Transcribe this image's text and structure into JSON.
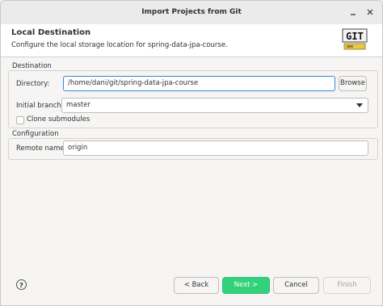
{
  "window": {
    "title": "Import Projects from Git"
  },
  "header": {
    "title": "Local Destination",
    "subtitle": "Configure the local storage location for spring-data-jpa-course.",
    "logo_text": "GIT"
  },
  "destination": {
    "group_label": "Destination",
    "directory_label": "Directory:",
    "directory_value": "/home/dani/git/spring-data-jpa-course",
    "browse_label": "Browse",
    "initial_branch_label": "Initial branch:",
    "initial_branch_value": "master",
    "clone_submodules_label": "Clone submodules"
  },
  "configuration": {
    "group_label": "Configuration",
    "remote_name_label": "Remote name:",
    "remote_name_value": "origin"
  },
  "footer": {
    "help_icon": "?",
    "back_label": "< Back",
    "next_label": "Next >",
    "cancel_label": "Cancel",
    "finish_label": "Finish"
  },
  "colors": {
    "accent": "#33d17a",
    "focus": "#3584e4"
  }
}
